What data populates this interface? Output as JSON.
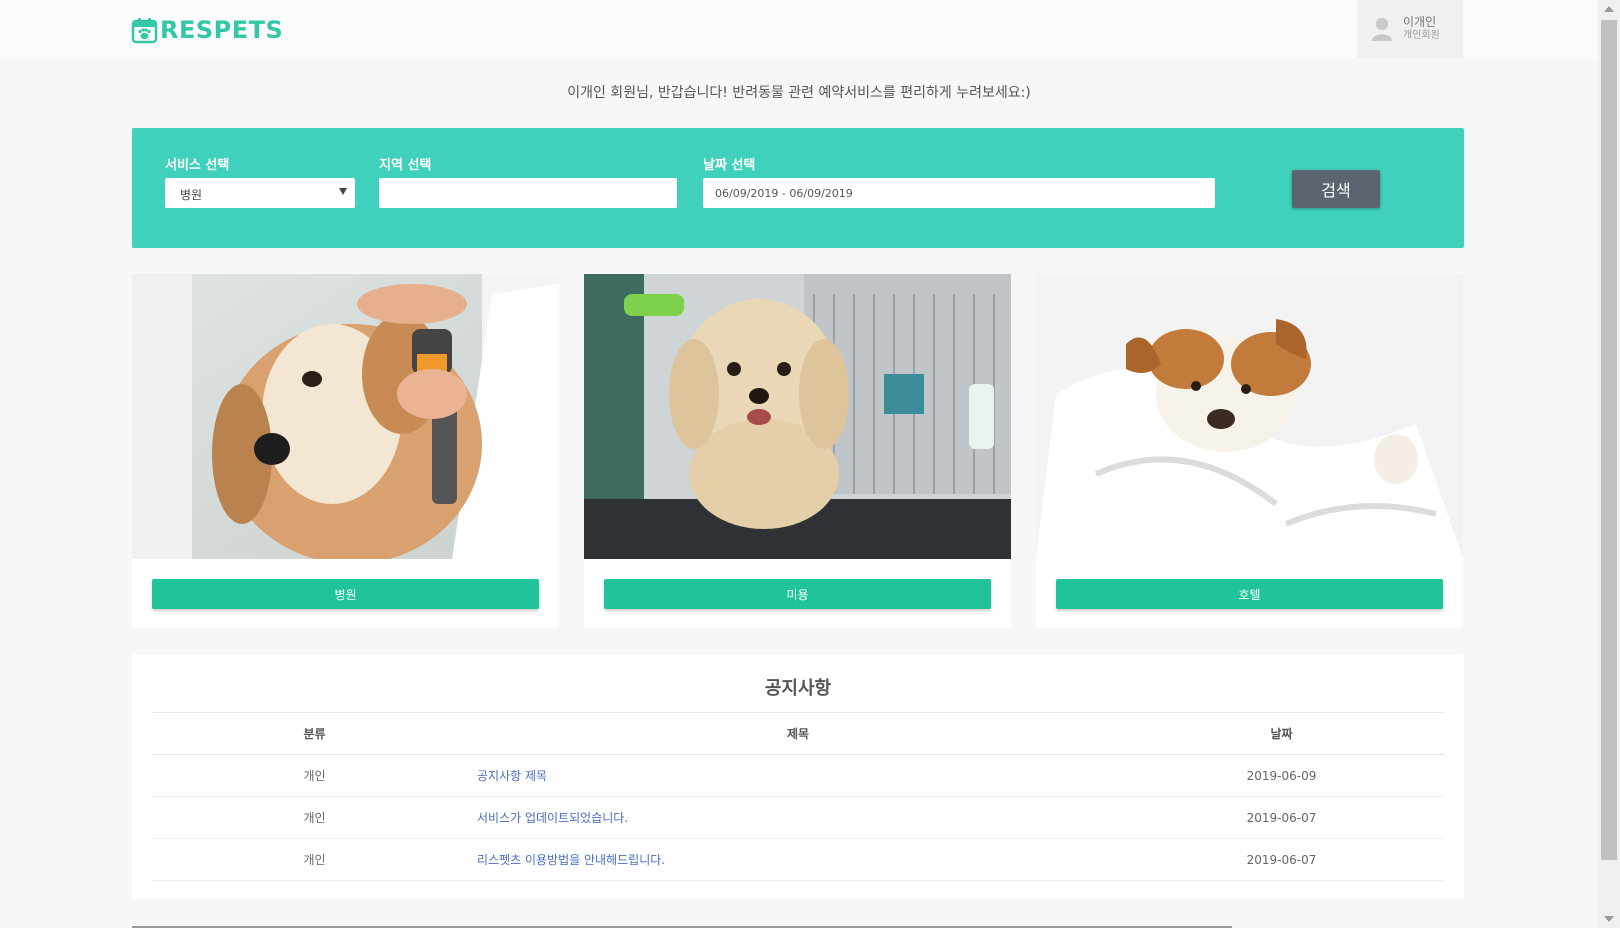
{
  "header": {
    "logo_text": "RESPETS",
    "user": {
      "name": "이개인",
      "type": "개인회원"
    }
  },
  "greeting": "이개인 회원님, 반갑습니다! 반려동물 관련 예약서비스를 편리하게 누려보세요:)",
  "search": {
    "service_label": "서비스 선택",
    "service_value": "병원",
    "region_label": "지역 선택",
    "region_value": "",
    "date_label": "날짜 선택",
    "date_value": "06/09/2019 - 06/09/2019",
    "button_label": "검색"
  },
  "services": [
    {
      "label": "병원",
      "image": "dog-vet-photo"
    },
    {
      "label": "미용",
      "image": "dog-grooming-photo"
    },
    {
      "label": "호텔",
      "image": "dog-hotel-photo"
    }
  ],
  "notice": {
    "title": "공지사항",
    "columns": [
      "분류",
      "제목",
      "날짜"
    ],
    "rows": [
      {
        "category": "개인",
        "title": "공지사항 제목",
        "date": "2019-06-09"
      },
      {
        "category": "개인",
        "title": "서비스가 업데이트되었습니다.",
        "date": "2019-06-07"
      },
      {
        "category": "개인",
        "title": "리스펫츠 이용방법을 안내해드립니다.",
        "date": "2019-06-07"
      }
    ]
  },
  "colors": {
    "brand": "#33c7a8",
    "search_panel": "#3fd1bb",
    "service_button": "#21c49a",
    "search_button": "#5b6470",
    "link": "#4a6dc4"
  }
}
